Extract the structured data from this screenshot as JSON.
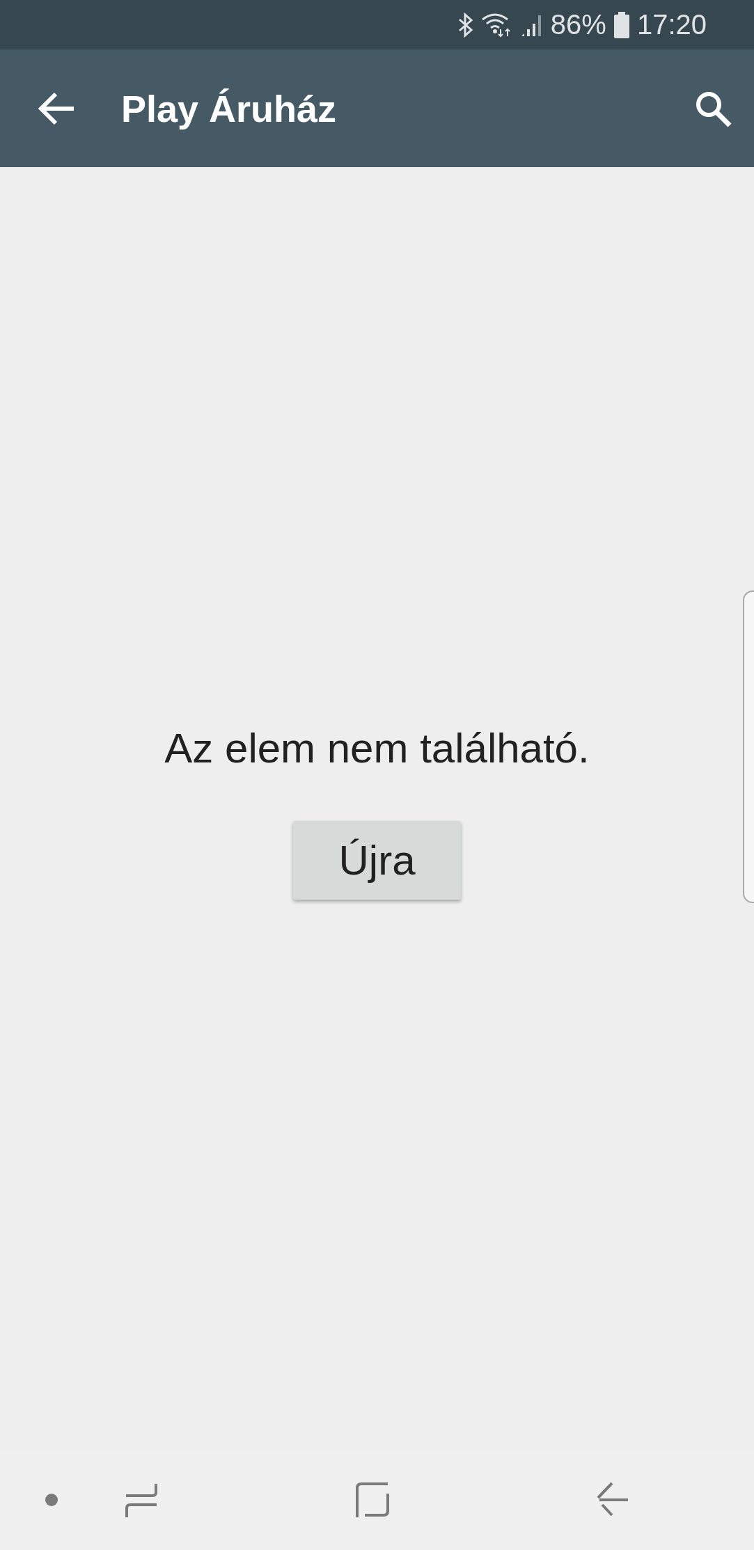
{
  "status_bar": {
    "battery": "86%",
    "time": "17:20"
  },
  "app_bar": {
    "title": "Play Áruház"
  },
  "message": "Az elem nem található.",
  "retry_button": {
    "label": "Újra"
  }
}
